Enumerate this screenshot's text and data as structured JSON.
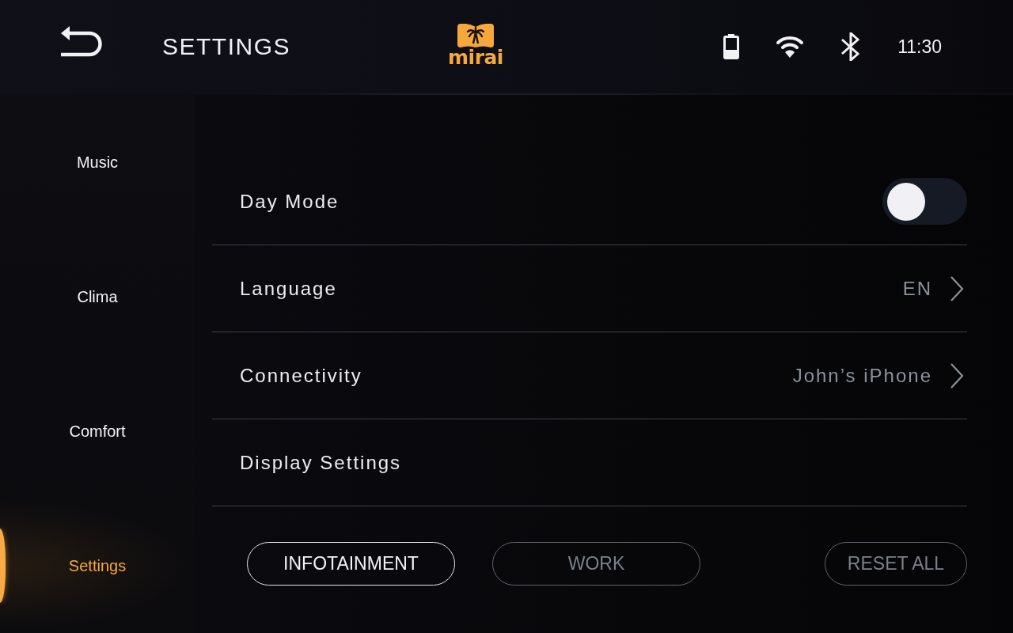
{
  "header": {
    "title": "SETTINGS",
    "logo_text": "mirai",
    "time": "11:30"
  },
  "sidebar": {
    "items": [
      {
        "label": "Music",
        "selected": false
      },
      {
        "label": "Clima",
        "selected": false
      },
      {
        "label": "Comfort",
        "selected": false
      },
      {
        "label": "Settings",
        "selected": true
      }
    ]
  },
  "settings": [
    {
      "kind": "toggle",
      "label": "Day Mode",
      "on": false
    },
    {
      "kind": "link",
      "label": "Language",
      "value": "EN"
    },
    {
      "kind": "link",
      "label": "Connectivity",
      "value": "John’s iPhone"
    },
    {
      "kind": "plain",
      "label": "Display Settings"
    }
  ],
  "profiles": [
    {
      "label": "INFOTAINMENT",
      "selected": true
    },
    {
      "label": "WORK",
      "selected": false
    }
  ],
  "reset_button": "RESET ALL"
}
